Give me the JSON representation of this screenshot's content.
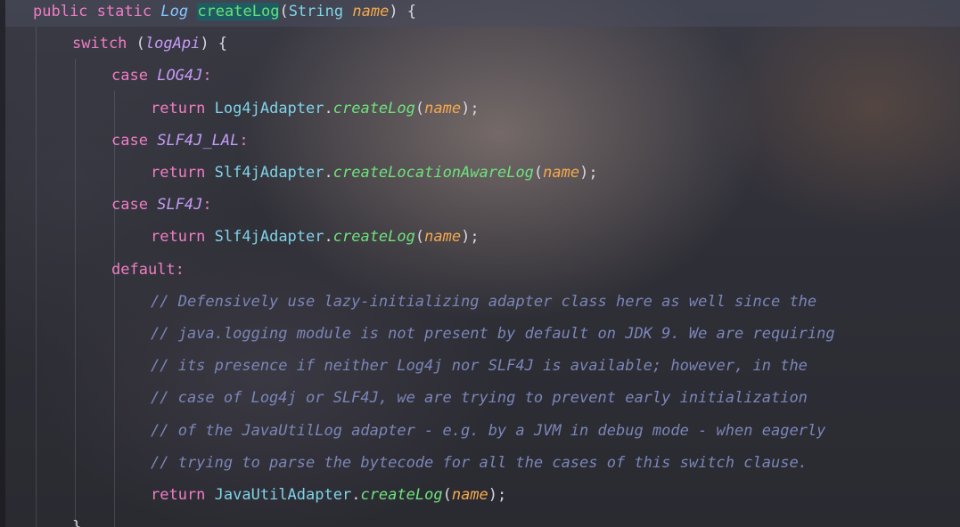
{
  "editor": {
    "lines": [
      {
        "tokens": [
          {
            "t": "public",
            "c": "kw"
          },
          {
            "t": " ",
            "c": "punct"
          },
          {
            "t": "static",
            "c": "kw"
          },
          {
            "t": " ",
            "c": "punct"
          },
          {
            "t": "Log",
            "c": "ital-type"
          },
          {
            "t": " ",
            "c": "punct"
          },
          {
            "t": "createLog",
            "c": "fn-decl"
          },
          {
            "t": "(",
            "c": "punct"
          },
          {
            "t": "String",
            "c": "type"
          },
          {
            "t": " ",
            "c": "punct"
          },
          {
            "t": "name",
            "c": "param"
          },
          {
            "t": ") {",
            "c": "punct"
          }
        ]
      },
      {
        "tokens": [
          {
            "t": "switch",
            "c": "kw"
          },
          {
            "t": " (",
            "c": "punct"
          },
          {
            "t": "logApi",
            "c": "field"
          },
          {
            "t": ") {",
            "c": "punct"
          }
        ]
      },
      {
        "tokens": [
          {
            "t": "case",
            "c": "kw"
          },
          {
            "t": " ",
            "c": "punct"
          },
          {
            "t": "LOG4J",
            "c": "field"
          },
          {
            "t": ":",
            "c": "kw"
          }
        ]
      },
      {
        "tokens": [
          {
            "t": "return",
            "c": "kw"
          },
          {
            "t": " ",
            "c": "punct"
          },
          {
            "t": "Log4jAdapter",
            "c": "type"
          },
          {
            "t": ".",
            "c": "punct"
          },
          {
            "t": "createLog",
            "c": "fn"
          },
          {
            "t": "(",
            "c": "punct"
          },
          {
            "t": "name",
            "c": "param"
          },
          {
            "t": ");",
            "c": "punct"
          }
        ]
      },
      {
        "tokens": [
          {
            "t": "case",
            "c": "kw"
          },
          {
            "t": " ",
            "c": "punct"
          },
          {
            "t": "SLF4J_LAL",
            "c": "field"
          },
          {
            "t": ":",
            "c": "kw"
          }
        ]
      },
      {
        "tokens": [
          {
            "t": "return",
            "c": "kw"
          },
          {
            "t": " ",
            "c": "punct"
          },
          {
            "t": "Slf4jAdapter",
            "c": "type"
          },
          {
            "t": ".",
            "c": "punct"
          },
          {
            "t": "createLocationAwareLog",
            "c": "fn"
          },
          {
            "t": "(",
            "c": "punct"
          },
          {
            "t": "name",
            "c": "param"
          },
          {
            "t": ");",
            "c": "punct"
          }
        ]
      },
      {
        "tokens": [
          {
            "t": "case",
            "c": "kw"
          },
          {
            "t": " ",
            "c": "punct"
          },
          {
            "t": "SLF4J",
            "c": "field"
          },
          {
            "t": ":",
            "c": "kw"
          }
        ]
      },
      {
        "tokens": [
          {
            "t": "return",
            "c": "kw"
          },
          {
            "t": " ",
            "c": "punct"
          },
          {
            "t": "Slf4jAdapter",
            "c": "type"
          },
          {
            "t": ".",
            "c": "punct"
          },
          {
            "t": "createLog",
            "c": "fn"
          },
          {
            "t": "(",
            "c": "punct"
          },
          {
            "t": "name",
            "c": "param"
          },
          {
            "t": ");",
            "c": "punct"
          }
        ]
      },
      {
        "tokens": [
          {
            "t": "default:",
            "c": "kw"
          }
        ]
      },
      {
        "tokens": [
          {
            "t": "// Defensively use lazy-initializing adapter class here as well since the",
            "c": "comment"
          }
        ]
      },
      {
        "tokens": [
          {
            "t": "// java.logging module is not present by default on JDK 9. We are requiring",
            "c": "comment"
          }
        ]
      },
      {
        "tokens": [
          {
            "t": "// its presence if neither Log4j nor SLF4J is available; however, in the",
            "c": "comment"
          }
        ]
      },
      {
        "tokens": [
          {
            "t": "// case of Log4j or SLF4J, we are trying to prevent early initialization",
            "c": "comment"
          }
        ]
      },
      {
        "tokens": [
          {
            "t": "// of the JavaUtilLog adapter - e.g. by a JVM in debug mode - when eagerly",
            "c": "comment"
          }
        ]
      },
      {
        "tokens": [
          {
            "t": "// trying to parse the bytecode for all the cases of this switch clause.",
            "c": "comment"
          }
        ]
      },
      {
        "tokens": [
          {
            "t": "return",
            "c": "kw"
          },
          {
            "t": " ",
            "c": "punct"
          },
          {
            "t": "JavaUtilAdapter",
            "c": "type"
          },
          {
            "t": ".",
            "c": "punct"
          },
          {
            "t": "createLog",
            "c": "fn"
          },
          {
            "t": "(",
            "c": "punct"
          },
          {
            "t": "name",
            "c": "param"
          },
          {
            "t": ");",
            "c": "punct"
          }
        ]
      },
      {
        "tokens": [
          {
            "t": "}",
            "c": "punct"
          }
        ]
      }
    ]
  }
}
